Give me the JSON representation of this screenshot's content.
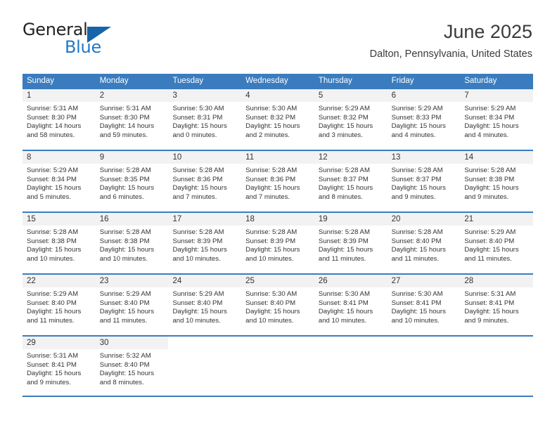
{
  "logo": {
    "word_one": "General",
    "word_two": "Blue",
    "triangle_icon": "blue-triangle-icon",
    "colors": {
      "general_text": "#222222",
      "blue_text": "#2278c4",
      "triangle": "#1565a8"
    }
  },
  "header": {
    "title": "June 2025",
    "subtitle": "Dalton, Pennsylvania, United States"
  },
  "theme": {
    "header_blue": "#3a7cbe",
    "daynum_band": "#f2f2f2",
    "text": "#333333"
  },
  "weekdays": [
    "Sunday",
    "Monday",
    "Tuesday",
    "Wednesday",
    "Thursday",
    "Friday",
    "Saturday"
  ],
  "weeks": [
    [
      {
        "day": "1",
        "sunrise": "Sunrise: 5:31 AM",
        "sunset": "Sunset: 8:30 PM",
        "daylight_line1": "Daylight: 14 hours",
        "daylight_line2": "and 58 minutes."
      },
      {
        "day": "2",
        "sunrise": "Sunrise: 5:31 AM",
        "sunset": "Sunset: 8:30 PM",
        "daylight_line1": "Daylight: 14 hours",
        "daylight_line2": "and 59 minutes."
      },
      {
        "day": "3",
        "sunrise": "Sunrise: 5:30 AM",
        "sunset": "Sunset: 8:31 PM",
        "daylight_line1": "Daylight: 15 hours",
        "daylight_line2": "and 0 minutes."
      },
      {
        "day": "4",
        "sunrise": "Sunrise: 5:30 AM",
        "sunset": "Sunset: 8:32 PM",
        "daylight_line1": "Daylight: 15 hours",
        "daylight_line2": "and 2 minutes."
      },
      {
        "day": "5",
        "sunrise": "Sunrise: 5:29 AM",
        "sunset": "Sunset: 8:32 PM",
        "daylight_line1": "Daylight: 15 hours",
        "daylight_line2": "and 3 minutes."
      },
      {
        "day": "6",
        "sunrise": "Sunrise: 5:29 AM",
        "sunset": "Sunset: 8:33 PM",
        "daylight_line1": "Daylight: 15 hours",
        "daylight_line2": "and 4 minutes."
      },
      {
        "day": "7",
        "sunrise": "Sunrise: 5:29 AM",
        "sunset": "Sunset: 8:34 PM",
        "daylight_line1": "Daylight: 15 hours",
        "daylight_line2": "and 4 minutes."
      }
    ],
    [
      {
        "day": "8",
        "sunrise": "Sunrise: 5:29 AM",
        "sunset": "Sunset: 8:34 PM",
        "daylight_line1": "Daylight: 15 hours",
        "daylight_line2": "and 5 minutes."
      },
      {
        "day": "9",
        "sunrise": "Sunrise: 5:28 AM",
        "sunset": "Sunset: 8:35 PM",
        "daylight_line1": "Daylight: 15 hours",
        "daylight_line2": "and 6 minutes."
      },
      {
        "day": "10",
        "sunrise": "Sunrise: 5:28 AM",
        "sunset": "Sunset: 8:36 PM",
        "daylight_line1": "Daylight: 15 hours",
        "daylight_line2": "and 7 minutes."
      },
      {
        "day": "11",
        "sunrise": "Sunrise: 5:28 AM",
        "sunset": "Sunset: 8:36 PM",
        "daylight_line1": "Daylight: 15 hours",
        "daylight_line2": "and 7 minutes."
      },
      {
        "day": "12",
        "sunrise": "Sunrise: 5:28 AM",
        "sunset": "Sunset: 8:37 PM",
        "daylight_line1": "Daylight: 15 hours",
        "daylight_line2": "and 8 minutes."
      },
      {
        "day": "13",
        "sunrise": "Sunrise: 5:28 AM",
        "sunset": "Sunset: 8:37 PM",
        "daylight_line1": "Daylight: 15 hours",
        "daylight_line2": "and 9 minutes."
      },
      {
        "day": "14",
        "sunrise": "Sunrise: 5:28 AM",
        "sunset": "Sunset: 8:38 PM",
        "daylight_line1": "Daylight: 15 hours",
        "daylight_line2": "and 9 minutes."
      }
    ],
    [
      {
        "day": "15",
        "sunrise": "Sunrise: 5:28 AM",
        "sunset": "Sunset: 8:38 PM",
        "daylight_line1": "Daylight: 15 hours",
        "daylight_line2": "and 10 minutes."
      },
      {
        "day": "16",
        "sunrise": "Sunrise: 5:28 AM",
        "sunset": "Sunset: 8:38 PM",
        "daylight_line1": "Daylight: 15 hours",
        "daylight_line2": "and 10 minutes."
      },
      {
        "day": "17",
        "sunrise": "Sunrise: 5:28 AM",
        "sunset": "Sunset: 8:39 PM",
        "daylight_line1": "Daylight: 15 hours",
        "daylight_line2": "and 10 minutes."
      },
      {
        "day": "18",
        "sunrise": "Sunrise: 5:28 AM",
        "sunset": "Sunset: 8:39 PM",
        "daylight_line1": "Daylight: 15 hours",
        "daylight_line2": "and 10 minutes."
      },
      {
        "day": "19",
        "sunrise": "Sunrise: 5:28 AM",
        "sunset": "Sunset: 8:39 PM",
        "daylight_line1": "Daylight: 15 hours",
        "daylight_line2": "and 11 minutes."
      },
      {
        "day": "20",
        "sunrise": "Sunrise: 5:28 AM",
        "sunset": "Sunset: 8:40 PM",
        "daylight_line1": "Daylight: 15 hours",
        "daylight_line2": "and 11 minutes."
      },
      {
        "day": "21",
        "sunrise": "Sunrise: 5:29 AM",
        "sunset": "Sunset: 8:40 PM",
        "daylight_line1": "Daylight: 15 hours",
        "daylight_line2": "and 11 minutes."
      }
    ],
    [
      {
        "day": "22",
        "sunrise": "Sunrise: 5:29 AM",
        "sunset": "Sunset: 8:40 PM",
        "daylight_line1": "Daylight: 15 hours",
        "daylight_line2": "and 11 minutes."
      },
      {
        "day": "23",
        "sunrise": "Sunrise: 5:29 AM",
        "sunset": "Sunset: 8:40 PM",
        "daylight_line1": "Daylight: 15 hours",
        "daylight_line2": "and 11 minutes."
      },
      {
        "day": "24",
        "sunrise": "Sunrise: 5:29 AM",
        "sunset": "Sunset: 8:40 PM",
        "daylight_line1": "Daylight: 15 hours",
        "daylight_line2": "and 10 minutes."
      },
      {
        "day": "25",
        "sunrise": "Sunrise: 5:30 AM",
        "sunset": "Sunset: 8:40 PM",
        "daylight_line1": "Daylight: 15 hours",
        "daylight_line2": "and 10 minutes."
      },
      {
        "day": "26",
        "sunrise": "Sunrise: 5:30 AM",
        "sunset": "Sunset: 8:41 PM",
        "daylight_line1": "Daylight: 15 hours",
        "daylight_line2": "and 10 minutes."
      },
      {
        "day": "27",
        "sunrise": "Sunrise: 5:30 AM",
        "sunset": "Sunset: 8:41 PM",
        "daylight_line1": "Daylight: 15 hours",
        "daylight_line2": "and 10 minutes."
      },
      {
        "day": "28",
        "sunrise": "Sunrise: 5:31 AM",
        "sunset": "Sunset: 8:41 PM",
        "daylight_line1": "Daylight: 15 hours",
        "daylight_line2": "and 9 minutes."
      }
    ],
    [
      {
        "day": "29",
        "sunrise": "Sunrise: 5:31 AM",
        "sunset": "Sunset: 8:41 PM",
        "daylight_line1": "Daylight: 15 hours",
        "daylight_line2": "and 9 minutes."
      },
      {
        "day": "30",
        "sunrise": "Sunrise: 5:32 AM",
        "sunset": "Sunset: 8:40 PM",
        "daylight_line1": "Daylight: 15 hours",
        "daylight_line2": "and 8 minutes."
      },
      {
        "day": "",
        "sunrise": "",
        "sunset": "",
        "daylight_line1": "",
        "daylight_line2": ""
      },
      {
        "day": "",
        "sunrise": "",
        "sunset": "",
        "daylight_line1": "",
        "daylight_line2": ""
      },
      {
        "day": "",
        "sunrise": "",
        "sunset": "",
        "daylight_line1": "",
        "daylight_line2": ""
      },
      {
        "day": "",
        "sunrise": "",
        "sunset": "",
        "daylight_line1": "",
        "daylight_line2": ""
      },
      {
        "day": "",
        "sunrise": "",
        "sunset": "",
        "daylight_line1": "",
        "daylight_line2": ""
      }
    ]
  ]
}
